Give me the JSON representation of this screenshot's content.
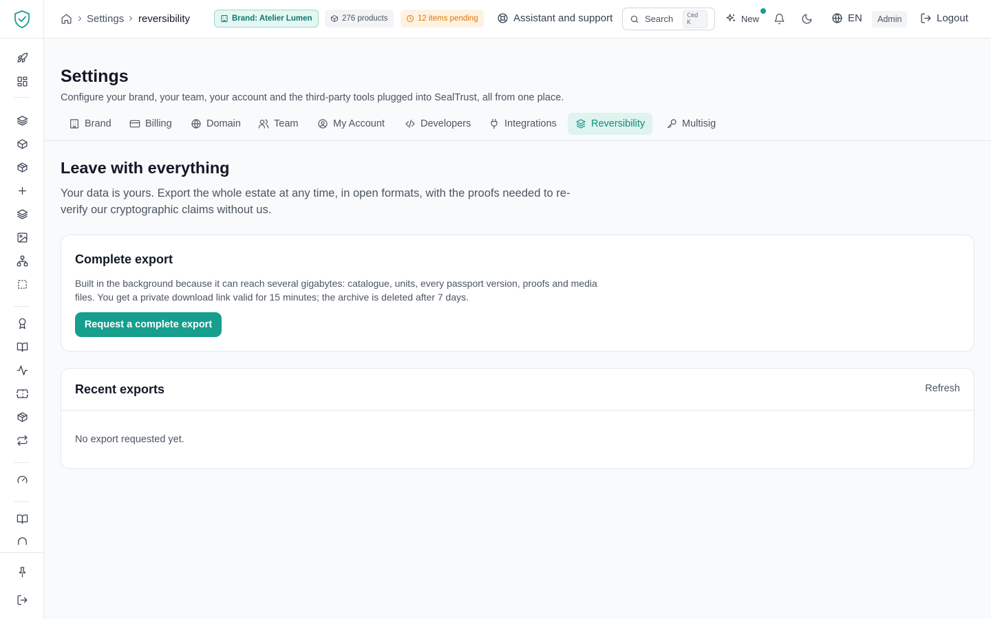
{
  "breadcrumb": {
    "root": "Settings",
    "current": "reversibility"
  },
  "pills": {
    "brand": "Brand: Atelier Lumen",
    "products": "276 products",
    "pending": "12 items pending"
  },
  "topbar": {
    "support": "Assistant and support",
    "search_label": "Search",
    "search_kbd": "Cmd K",
    "new_label": "New",
    "language": "EN",
    "role": "Admin",
    "logout": "Logout"
  },
  "header": {
    "title": "Settings",
    "subtitle": "Configure your brand, your team, your account and the third-party tools plugged into SealTrust, all from one place."
  },
  "tabs": [
    {
      "label": "Brand",
      "icon": "building-icon"
    },
    {
      "label": "Billing",
      "icon": "credit-card-icon"
    },
    {
      "label": "Domain",
      "icon": "globe-icon"
    },
    {
      "label": "Team",
      "icon": "users-icon"
    },
    {
      "label": "My Account",
      "icon": "user-circle-icon"
    },
    {
      "label": "Developers",
      "icon": "code-icon"
    },
    {
      "label": "Integrations",
      "icon": "plug-icon"
    },
    {
      "label": "Reversibility",
      "icon": "package-return-icon",
      "active": true
    },
    {
      "label": "Multisig",
      "icon": "key-icon"
    }
  ],
  "main": {
    "title": "Leave with everything",
    "description": "Your data is yours. Export the whole estate at any time, in open formats, with the proofs needed to re-verify our cryptographic claims without us."
  },
  "export_card": {
    "title": "Complete export",
    "description": "Built in the background because it can reach several gigabytes: catalogue, units, every passport version, proofs and media files. You get a private download link valid for 15 minutes; the archive is deleted after 7 days.",
    "button": "Request a complete export"
  },
  "recent_card": {
    "title": "Recent exports",
    "refresh": "Refresh",
    "empty": "No export requested yet."
  },
  "colors": {
    "accent": "#169e8e",
    "accent_soft": "#dff3ef",
    "pending": "#d97706"
  }
}
